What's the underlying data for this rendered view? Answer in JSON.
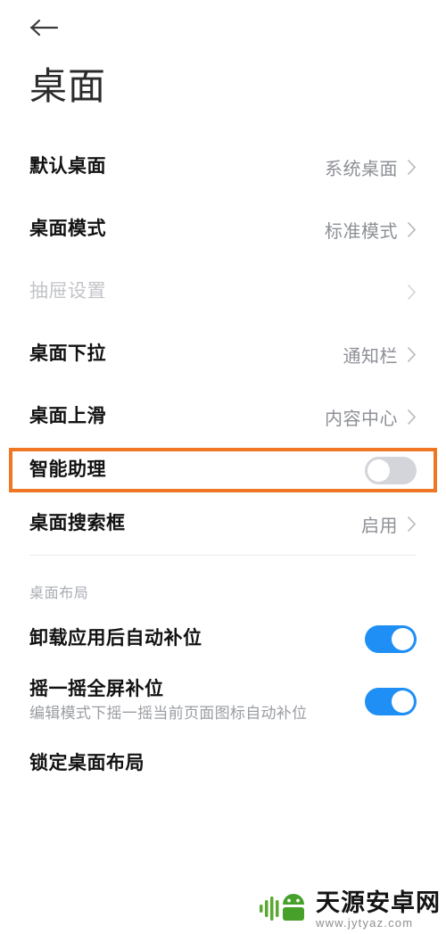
{
  "header": {
    "back_icon": "back-arrow-icon",
    "title": "桌面"
  },
  "colors": {
    "accent_toggle_on": "#1f8ff5",
    "toggle_off": "#d3d5da",
    "highlight_border": "#ef7622",
    "value_text": "#8d9096",
    "section_text": "#a9acb4",
    "disabled_text": "#c2c4c8"
  },
  "list": {
    "rows": [
      {
        "label": "默认桌面",
        "value": "系统桌面",
        "control": "chevron",
        "disabled": false,
        "highlight": false
      },
      {
        "label": "桌面模式",
        "value": "标准模式",
        "control": "chevron",
        "disabled": false,
        "highlight": false
      },
      {
        "label": "抽屉设置",
        "value": "",
        "control": "chevron",
        "disabled": true,
        "highlight": false
      },
      {
        "label": "桌面下拉",
        "value": "通知栏",
        "control": "chevron",
        "disabled": false,
        "highlight": false
      },
      {
        "label": "桌面上滑",
        "value": "内容中心",
        "control": "chevron",
        "disabled": false,
        "highlight": false
      },
      {
        "label": "智能助理",
        "value": "",
        "control": "toggle-off",
        "disabled": false,
        "highlight": true
      },
      {
        "label": "桌面搜索框",
        "value": "启用",
        "control": "chevron",
        "disabled": false,
        "highlight": false
      }
    ]
  },
  "section_layout": {
    "title": "桌面布局",
    "rows": [
      {
        "label": "卸载应用后自动补位",
        "sub": "",
        "control": "toggle-on"
      },
      {
        "label": "摇一摇全屏补位",
        "sub": "编辑模式下摇一摇当前页面图标自动补位",
        "control": "toggle-on"
      },
      {
        "label": "锁定桌面布局",
        "sub": "",
        "control": "none"
      }
    ]
  },
  "watermark": {
    "logo_icon": "android-robot-logo-icon",
    "name": "天源安卓网",
    "url": "www.jytyaz.com"
  }
}
